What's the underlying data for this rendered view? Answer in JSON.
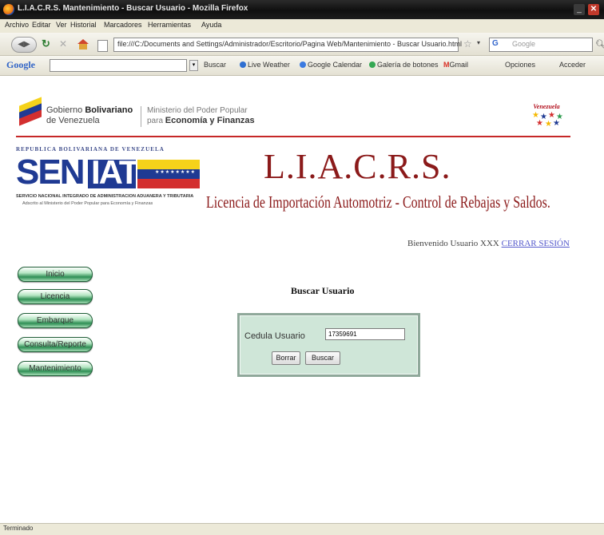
{
  "window": {
    "title": "L.I.A.C.R.S. Mantenimiento - Buscar Usuario - Mozilla Firefox"
  },
  "menubar": [
    "Archivo",
    "Editar",
    "Ver",
    "Historial",
    "Marcadores",
    "Herramientas",
    "Ayuda"
  ],
  "navbar": {
    "url": "file:///C:/Documents and Settings/Administrador/Escritorio/Pagina Web/Mantenimiento - Buscar Usuario.html",
    "search_placeholder": "Google"
  },
  "google_toolbar": {
    "logo": "Google",
    "items": [
      "Buscar",
      "Live Weather",
      "Google Calendar",
      "Galería de botones",
      "Gmail",
      "Opciones",
      "Acceder"
    ]
  },
  "header": {
    "gob_line1": "Gobierno",
    "gob_line1_bold": "Bolivariano",
    "gob_line2": "de Venezuela",
    "ministerio_line1": "Ministerio del Poder Popular",
    "ministerio_line2": "para",
    "ministerio_line2_bold": "Economía y Finanzas",
    "venezuela_logo_text": "Venezuela",
    "republica": "REPUBLICA BOLIVARIANA DE VENEZUELA",
    "seniat_sen": "SEN",
    "seniat_iat": "IAT",
    "seniat_sub1": "SERVICIO NACIONAL INTEGRADO DE ADMINISTRACION ADUANERA Y TRIBUTARIA",
    "seniat_sub2": "Adscrito al Ministerio del Poder Popular para Economía y Finanzas"
  },
  "app": {
    "title": "L.I.A.C.R.S.",
    "subtitle": "Licencia de Importación Automotriz - Control de Rebajas y Saldos."
  },
  "session": {
    "welcome": "Bienvenido Usuario XXX",
    "logout": "CERRAR SESIÓN"
  },
  "nav_menu": [
    "Inicio",
    "Licencia",
    "Embarque",
    "Consulta/Reporte",
    "Mantenimiento"
  ],
  "form": {
    "heading": "Buscar Usuario",
    "cedula_label": "Cedula Usuario",
    "cedula_value": "17359691",
    "borrar": "Borrar",
    "buscar": "Buscar"
  },
  "status": "Terminado",
  "colors": {
    "brand_red": "#8b1a1a",
    "menu_green": "#2f8f55",
    "form_bg": "#cfe6d8",
    "link": "#555acc"
  }
}
